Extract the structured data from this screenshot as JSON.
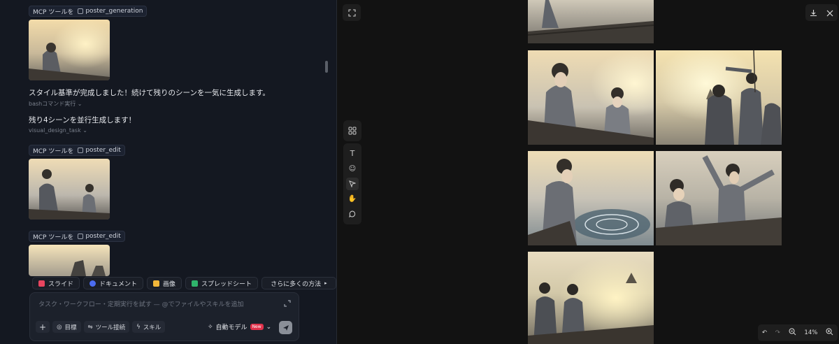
{
  "chat": {
    "tool_calls": [
      {
        "prefix": "MCP ツールを",
        "tool": "poster_generation"
      },
      {
        "prefix": "MCP ツールを",
        "tool": "poster_edit"
      },
      {
        "prefix": "MCP ツールを",
        "tool": "poster_edit"
      }
    ],
    "messages": [
      {
        "text": "スタイル基準が完成しました！続けて残りのシーンを一気に生成します。",
        "sub": "bashコマンド実行"
      },
      {
        "text": "残り4シーンを並行生成します！",
        "sub": "visual_design_task"
      }
    ]
  },
  "chips": [
    {
      "label": "スライド",
      "icon": "slides-icon",
      "color": "#e8455f"
    },
    {
      "label": "ドキュメント",
      "icon": "document-icon",
      "color": "#4b6cf0"
    },
    {
      "label": "画像",
      "icon": "image-icon",
      "color": "#f2b73a"
    },
    {
      "label": "スプレッドシート",
      "icon": "spreadsheet-icon",
      "color": "#2fb36b"
    },
    {
      "label": "さらに多くの方法",
      "icon": "chevron-right-icon"
    }
  ],
  "composer": {
    "placeholder": "タスク・ワークフロー・定期実行を試す — @でファイルやスキルを追加",
    "controls": {
      "goal": "目標",
      "tools": "ツール接続",
      "skills": "スキル"
    },
    "model": "自動モデル",
    "model_badge": "New"
  },
  "canvas": {
    "zoom": "14%"
  }
}
